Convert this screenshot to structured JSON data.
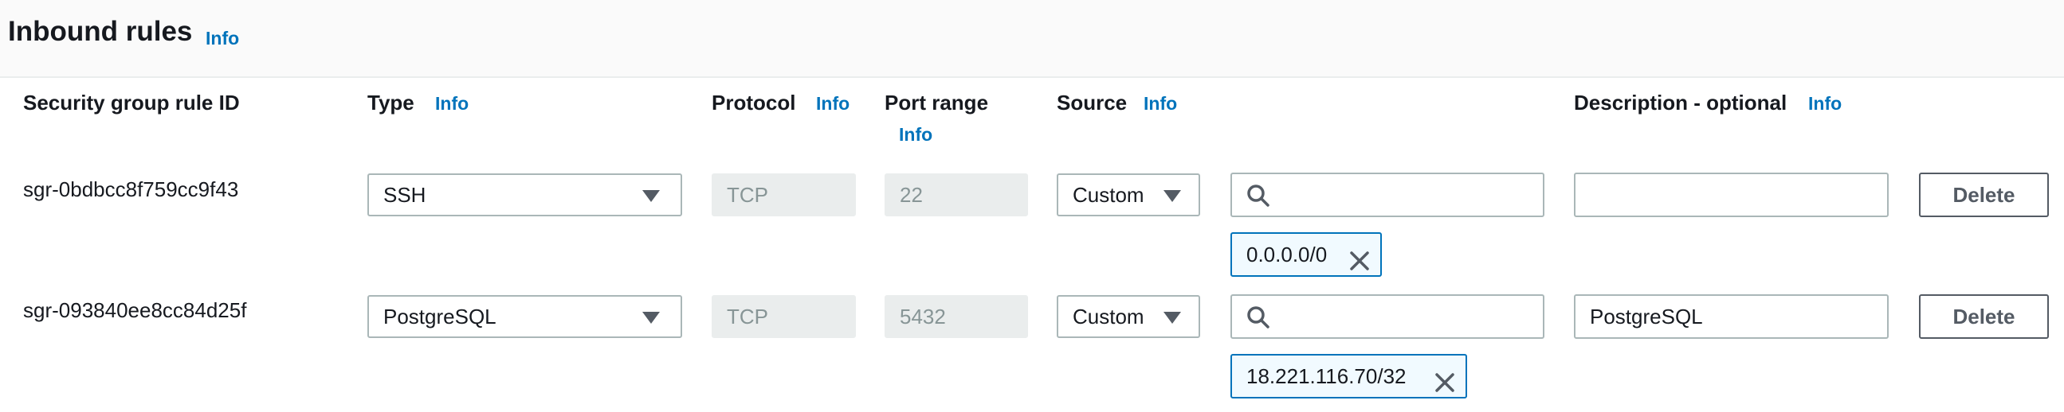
{
  "header": {
    "title": "Inbound rules",
    "info": "Info"
  },
  "columns": {
    "rule_id": "Security group rule ID",
    "type": "Type",
    "type_info": "Info",
    "protocol": "Protocol",
    "protocol_info": "Info",
    "port_range": "Port range",
    "port_range_info": "Info",
    "source": "Source",
    "source_info": "Info",
    "description": "Description - optional",
    "description_info": "Info"
  },
  "rules": [
    {
      "id": "sgr-0bdbcc8f759cc9f43",
      "type": "SSH",
      "protocol": "TCP",
      "port_range": "22",
      "source_type": "Custom",
      "search_value": "",
      "cidr": "0.0.0.0/0",
      "description": "",
      "delete_label": "Delete"
    },
    {
      "id": "sgr-093840ee8cc84d25f",
      "type": "PostgreSQL",
      "protocol": "TCP",
      "port_range": "5432",
      "source_type": "Custom",
      "search_value": "",
      "cidr": "18.221.116.70/32",
      "description": "PostgreSQL",
      "delete_label": "Delete"
    }
  ],
  "icons": {
    "search": "search-icon",
    "remove": "close-icon",
    "dropdown": "caret-down-icon"
  },
  "colors": {
    "link": "#0073bb",
    "token_border": "#0073bb",
    "token_bg": "#f1faff",
    "disabled_bg": "#eaeded"
  }
}
